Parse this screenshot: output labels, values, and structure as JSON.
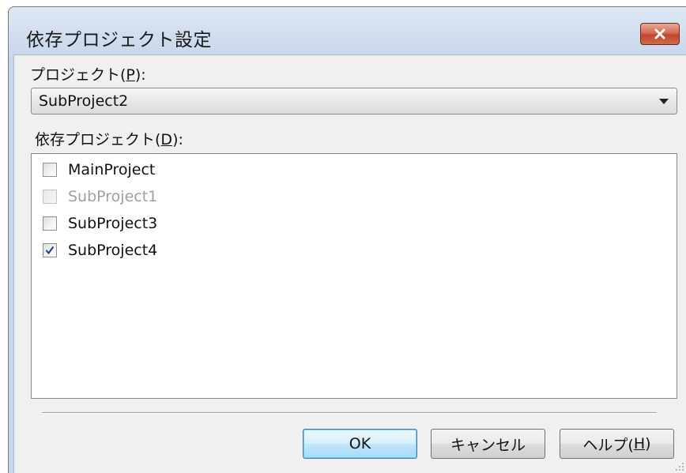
{
  "window": {
    "title": "依存プロジェクト設定"
  },
  "project": {
    "label_prefix": "プロジェクト(",
    "label_key": "P",
    "label_suffix": "):",
    "selected": "SubProject2"
  },
  "dependencies": {
    "label_prefix": "依存プロジェクト(",
    "label_key": "D",
    "label_suffix": "):",
    "items": [
      {
        "name": "MainProject",
        "checked": false,
        "enabled": true
      },
      {
        "name": "SubProject1",
        "checked": false,
        "enabled": false
      },
      {
        "name": "SubProject3",
        "checked": false,
        "enabled": true
      },
      {
        "name": "SubProject4",
        "checked": true,
        "enabled": true
      }
    ]
  },
  "buttons": {
    "ok": "OK",
    "cancel": "キャンセル",
    "help_prefix": "ヘルプ(",
    "help_key": "H",
    "help_suffix": ")"
  },
  "colors": {
    "check_mark": "#1e3f8a",
    "close_button": "#c2452b"
  },
  "icons": {
    "close": "close-icon",
    "dropdown": "chevron-down-icon",
    "check": "checkmark-icon",
    "grip": "resize-grip-icon"
  }
}
